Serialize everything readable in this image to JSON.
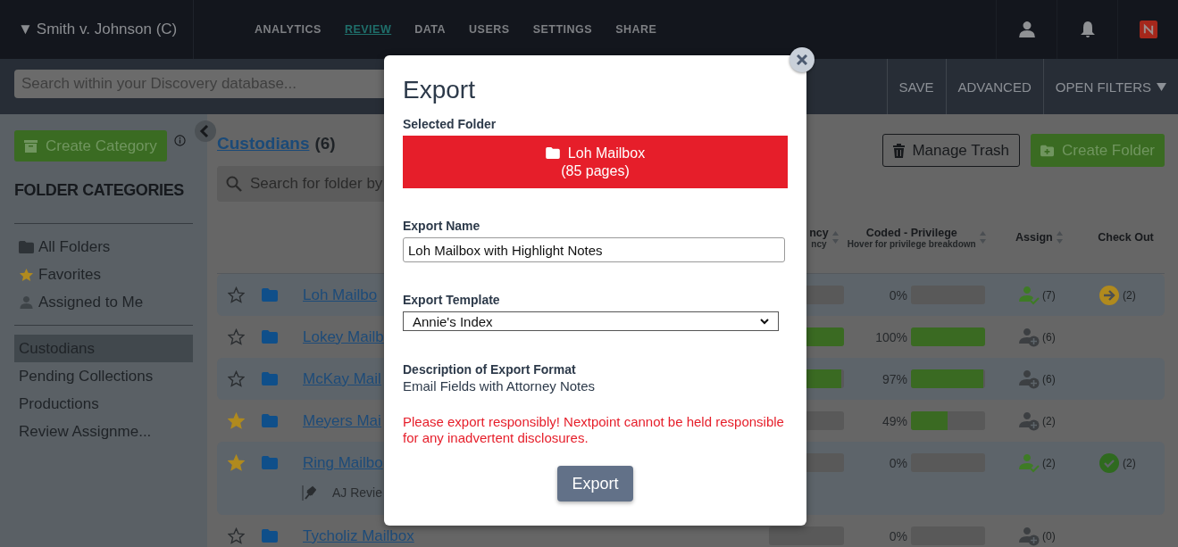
{
  "case_menu": {
    "caret": "▼",
    "label": "Smith v. Johnson (C)"
  },
  "nav": [
    {
      "label": "ANALYTICS",
      "selected": false
    },
    {
      "label": "REVIEW",
      "selected": true
    },
    {
      "label": "DATA",
      "selected": false
    },
    {
      "label": "USERS",
      "selected": false
    },
    {
      "label": "SETTINGS",
      "selected": false
    },
    {
      "label": "SHARE",
      "selected": false
    }
  ],
  "toolbar": {
    "search": {
      "placeholder": "Search within your Discovery database..."
    },
    "buttons": [
      {
        "label": "SAVE",
        "dropdown": false
      },
      {
        "label": "ADVANCED",
        "dropdown": false
      },
      {
        "label": "OPEN FILTERS",
        "dropdown": true
      }
    ]
  },
  "sidebar": {
    "create_button": "Create Category",
    "heading": "FOLDER CATEGORIES",
    "groups": [
      [
        {
          "label": "All Folders",
          "kind": "folder",
          "selected": false
        },
        {
          "label": "Favorites",
          "kind": "star",
          "selected": false
        },
        {
          "label": "Assigned to Me",
          "kind": "person",
          "selected": false
        }
      ],
      [
        {
          "label": "Custodians",
          "kind": "plain",
          "selected": true
        },
        {
          "label": "Pending Collections",
          "kind": "plain",
          "selected": false
        },
        {
          "label": "Productions",
          "kind": "plain",
          "selected": false
        },
        {
          "label": "Review Assignme...",
          "kind": "plain",
          "selected": false
        }
      ]
    ]
  },
  "main": {
    "title": "Custodians",
    "count": "(6)",
    "search": {
      "placeholder": "Search for folder by"
    },
    "buttons": [
      {
        "label": "Manage Trash",
        "kind": "trash"
      },
      {
        "label": "Create Folder",
        "kind": "create"
      }
    ],
    "columns": [
      {
        "label": "ncy",
        "note": "ncy",
        "sortable": true
      },
      {
        "label": "Coded - Privilege",
        "note": "Hover for privilege breakdown",
        "sortable": true
      },
      {
        "label": "Assign",
        "sortable": true
      },
      {
        "label": "Check Out",
        "sortable": false
      }
    ],
    "rows": [
      {
        "favorite": false,
        "name": "Loh Mailbo",
        "col_1": {
          "level": 0
        },
        "privilege": {
          "reading": "0%",
          "level": 0
        },
        "assign": {
          "kind": "assigned",
          "count": "(7)"
        },
        "check_out": {
          "kind": "arrow",
          "count": "(2)"
        }
      },
      {
        "favorite": false,
        "name": "Lokey Mailb",
        "col_1": {
          "level": 1
        },
        "privilege": {
          "reading": "100%",
          "level": 1
        },
        "assign": {
          "kind": "add",
          "count": "(6)"
        },
        "check_out": {
          "kind": "none"
        }
      },
      {
        "favorite": false,
        "name": "McKay Mail",
        "col_1": {
          "level": 0.97
        },
        "privilege": {
          "reading": "97%",
          "level": 0.97
        },
        "assign": {
          "kind": "add",
          "count": "(6)"
        },
        "check_out": {
          "kind": "none"
        }
      },
      {
        "favorite": true,
        "name": "Meyers Mai",
        "col_1": {
          "level": 0
        },
        "privilege": {
          "reading": "49%",
          "level": 0.49
        },
        "assign": {
          "kind": "add",
          "count": "(2)"
        },
        "check_out": {
          "kind": "none"
        }
      },
      {
        "favorite": true,
        "name": "Ring Mailbo",
        "pinned": "AJ Revie",
        "col_1": {
          "level": 0
        },
        "privilege": {
          "reading": "0%",
          "level": 0
        },
        "assign": {
          "kind": "assigned",
          "count": "(2)"
        },
        "check_out": {
          "kind": "check",
          "count": "(2)"
        }
      },
      {
        "favorite": false,
        "name": "Tycholiz Mailbox",
        "col_1": {
          "level": 0
        },
        "privilege": {
          "reading": "0%",
          "level": 0
        },
        "assign": {
          "kind": "add",
          "count": "(0)"
        },
        "check_out": {
          "kind": "none"
        }
      }
    ]
  },
  "export_dialog": {
    "title": "Export",
    "selected_folder": {
      "label": "Selected Folder",
      "name": "Loh Mailbox",
      "pages": "(85 pages)"
    },
    "export_name": {
      "label": "Export Name",
      "value": "Loh Mailbox with Highlight Notes"
    },
    "export_template": {
      "label": "Export Template",
      "value": "Annie's Index"
    },
    "description": {
      "label": "Description of Export Format",
      "text": "Email Fields with Attorney Notes"
    },
    "warning": "Please export responsibly! Nextpoint cannot be held responsible for any inadvertent disclosures.",
    "button": "Export"
  }
}
